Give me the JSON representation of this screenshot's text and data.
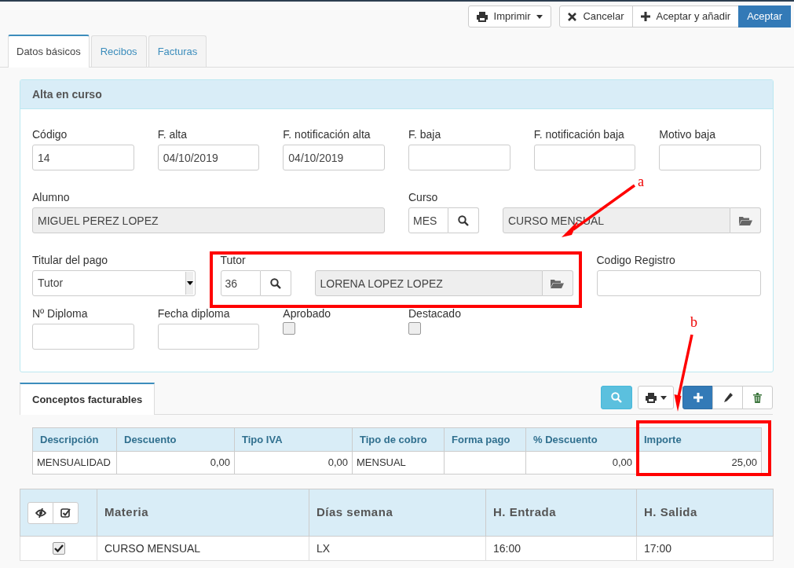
{
  "toolbar": {
    "print": {
      "label": "Imprimir"
    },
    "actions": [
      {
        "label": "Cancelar",
        "kind": "cancel"
      },
      {
        "label": "Aceptar y añadir",
        "kind": "add"
      },
      {
        "label": "Aceptar",
        "kind": "primary"
      }
    ]
  },
  "tabs": [
    {
      "label": "Datos básicos",
      "selected": true
    },
    {
      "label": "Recibos",
      "selected": false
    },
    {
      "label": "Facturas",
      "selected": false
    }
  ],
  "panel": {
    "title": "Alta en curso",
    "rows": [
      [
        {
          "kind": "input",
          "label": "Código",
          "value": "14"
        },
        {
          "kind": "input",
          "label": "F. alta",
          "value": "04/10/2019"
        },
        {
          "kind": "input",
          "label": "F. notificación alta",
          "value": "04/10/2019"
        },
        {
          "kind": "input",
          "label": "F. baja"
        },
        {
          "kind": "input",
          "label": "F. notificación baja"
        },
        {
          "kind": "input",
          "label": "Motivo baja"
        }
      ],
      [
        {
          "kind": "display",
          "label": "Alumno",
          "value": "MIGUEL PEREZ LOPEZ"
        },
        {
          "kind": "lookup",
          "label": "Curso",
          "code": "MES",
          "name": "CURSO MENSUAL"
        }
      ],
      [
        {
          "kind": "select",
          "label": "Titular del pago",
          "value": "Tutor"
        },
        {
          "kind": "lookup",
          "label": "Tutor",
          "code": "36",
          "name": "LORENA LOPEZ LOPEZ"
        },
        {
          "kind": "input",
          "label": "Codigo Registro"
        }
      ],
      [
        {
          "kind": "input",
          "label": "Nº Diploma"
        },
        {
          "kind": "input",
          "label": "Fecha diploma"
        },
        {
          "kind": "checkbox",
          "label": "Aprobado",
          "checked": false
        },
        {
          "kind": "checkbox",
          "label": "Destacado",
          "checked": false
        }
      ]
    ]
  },
  "conceptos": {
    "tab": {
      "label": "Conceptos facturables",
      "selected": true
    },
    "tools": [
      {
        "kind": "search"
      },
      {
        "kind": "print"
      },
      {
        "kind": "add"
      },
      {
        "kind": "edit"
      },
      {
        "kind": "delete"
      }
    ],
    "columns": [
      {
        "label": "Descripción",
        "numeric": false
      },
      {
        "label": "Descuento",
        "numeric": true
      },
      {
        "label": "Tipo IVA",
        "numeric": true
      },
      {
        "label": "Tipo de cobro",
        "numeric": false
      },
      {
        "label": "Forma pago"
      },
      {
        "label": "% Descuento",
        "numeric": true
      },
      {
        "label": "Importe",
        "numeric": true
      }
    ],
    "rows": [
      [
        "MENSUALIDAD",
        "0,00",
        "0,00",
        "MENSUAL",
        null,
        "0,00",
        "25,00"
      ]
    ]
  },
  "materias": {
    "columns": [
      "Materia",
      "Días semana",
      "H. Entrada",
      "H. Salida"
    ],
    "rows": [
      {
        "checked": true,
        "cells": [
          "CURSO MENSUAL",
          "LX",
          "16:00",
          "17:00"
        ]
      }
    ]
  },
  "annotations": [
    {
      "label": "a"
    },
    {
      "label": "b"
    }
  ]
}
